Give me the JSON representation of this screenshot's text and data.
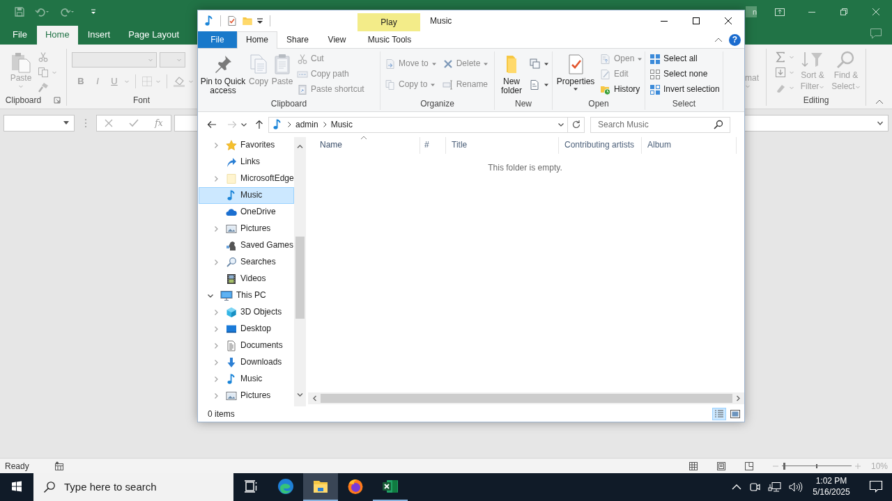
{
  "excel": {
    "tabs": [
      {
        "label": "File",
        "selected": false
      },
      {
        "label": "Home",
        "selected": true
      },
      {
        "label": "Insert",
        "selected": false
      },
      {
        "label": "Page Layout",
        "selected": false
      }
    ],
    "sign_in": "n",
    "paste": "Paste",
    "clipboard_group": "Clipboard",
    "font_buttons": [
      {
        "label": "B",
        "kind": "bold"
      },
      {
        "label": "I",
        "kind": "italic"
      },
      {
        "label": "U",
        "kind": "underline"
      }
    ],
    "font_group": "Font",
    "format_partial": "mat",
    "sort_filter": "Sort & Filter",
    "find_select": "Find & Select",
    "editing_group": "Editing",
    "formula_label": "fx",
    "status": "Ready",
    "zoom": "10%",
    "zoom_slider": {
      "level": 0.02
    }
  },
  "explorer": {
    "title": "Music",
    "context_header": "Play",
    "tabs": [
      {
        "label": "File",
        "kind": "file",
        "selected": false
      },
      {
        "label": "Home",
        "kind": "tab",
        "selected": true
      },
      {
        "label": "Share",
        "kind": "tab",
        "selected": false
      },
      {
        "label": "View",
        "kind": "tab",
        "selected": false
      },
      {
        "label": "Music Tools",
        "kind": "context",
        "selected": false
      }
    ],
    "help": "?",
    "ribbon": [
      {
        "label": "Clipboard",
        "columns": [
          [
            {
              "kind": "pin",
              "label": "Pin to Quick access",
              "disabled": false
            }
          ],
          [
            {
              "kind": "copy",
              "label": "Copy",
              "disabled": true
            }
          ],
          [
            {
              "kind": "paste",
              "label": "Paste",
              "disabled": true
            }
          ],
          [
            {
              "kind": "cut",
              "label": "Cut",
              "disabled": true
            },
            {
              "kind": "copy-path",
              "label": "Copy path",
              "disabled": true
            },
            {
              "kind": "paste-shortcut",
              "label": "Paste shortcut",
              "disabled": true
            }
          ]
        ]
      },
      {
        "label": "Organize",
        "columns": [
          [
            {
              "kind": "move-to",
              "label": "Move to",
              "dropdown": true,
              "disabled": true
            },
            {
              "kind": "copy-to",
              "label": "Copy to",
              "dropdown": true,
              "disabled": true
            }
          ],
          [
            {
              "kind": "delete",
              "label": "Delete",
              "dropdown": true,
              "disabled": true
            },
            {
              "kind": "rename",
              "label": "Rename",
              "disabled": true
            }
          ]
        ]
      },
      {
        "label": "New",
        "columns": [
          [
            {
              "kind": "new-folder",
              "label": "New folder",
              "disabled": false
            }
          ],
          [
            {
              "kind": "new-item",
              "dropdown": true,
              "disabled": false
            },
            {
              "kind": "easy-access",
              "dropdown": true,
              "disabled": false
            }
          ]
        ]
      },
      {
        "label": "Open",
        "columns": [
          [
            {
              "kind": "properties",
              "label": "Properties",
              "dropdown": true,
              "disabled": false
            }
          ],
          [
            {
              "kind": "open",
              "label": "Open",
              "dropdown": true,
              "disabled": true
            },
            {
              "kind": "edit",
              "label": "Edit",
              "disabled": true
            },
            {
              "kind": "history",
              "label": "History",
              "disabled": false
            }
          ]
        ]
      },
      {
        "label": "Select",
        "columns": [
          [
            {
              "kind": "select-all",
              "label": "Select all",
              "disabled": false
            },
            {
              "kind": "select-none",
              "label": "Select none",
              "disabled": false
            },
            {
              "kind": "invert-selection",
              "label": "Invert selection",
              "disabled": false
            }
          ]
        ]
      }
    ],
    "history_buttons": [
      {
        "kind": "back",
        "disabled": false
      },
      {
        "kind": "forward",
        "disabled": true
      }
    ],
    "address": [
      "admin",
      "Music"
    ],
    "search_placeholder": "Search Music",
    "nav": [
      {
        "children": [
          {
            "label": "Favorites",
            "kind": "star",
            "expanded": false,
            "selected": false
          },
          {
            "label": "Links",
            "kind": "link",
            "selected": false
          },
          {
            "label": "MicrosoftEdge",
            "kind": "folder",
            "expanded": false,
            "selected": false
          },
          {
            "label": "Music",
            "kind": "music",
            "selected": true
          },
          {
            "label": "OneDrive",
            "kind": "cloud",
            "selected": false
          },
          {
            "label": "Pictures",
            "kind": "pictures",
            "expanded": false,
            "selected": false
          },
          {
            "label": "Saved Games",
            "kind": "games",
            "selected": false
          },
          {
            "label": "Searches",
            "kind": "search",
            "expanded": false,
            "selected": false
          },
          {
            "label": "Videos",
            "kind": "videos",
            "selected": false
          }
        ]
      },
      {
        "label": "This PC",
        "kind": "pc",
        "expanded": true,
        "selected": false,
        "children": [
          {
            "label": "3D Objects",
            "kind": "cube",
            "expanded": false,
            "selected": false
          },
          {
            "label": "Desktop",
            "kind": "desktop",
            "expanded": false,
            "selected": false
          },
          {
            "label": "Documents",
            "kind": "documents",
            "expanded": false,
            "selected": false
          },
          {
            "label": "Downloads",
            "kind": "downloads",
            "expanded": false,
            "selected": false
          },
          {
            "label": "Music",
            "kind": "music",
            "expanded": false,
            "selected": false
          },
          {
            "label": "Pictures",
            "kind": "pictures",
            "expanded": false,
            "selected": false
          }
        ]
      }
    ],
    "columns": [
      {
        "label": "Name",
        "sorted": true
      },
      {
        "label": "#",
        "sorted": false
      },
      {
        "label": "Title",
        "sorted": false
      },
      {
        "label": "Contributing artists",
        "sorted": false
      },
      {
        "label": "Album",
        "sorted": false
      }
    ],
    "empty_message": "This folder is empty.",
    "status": "0 items",
    "views": [
      {
        "kind": "details",
        "selected": true
      },
      {
        "kind": "large-icons",
        "selected": false
      }
    ]
  },
  "taskbar": {
    "search_placeholder": "Type here to search",
    "apps": [
      {
        "kind": "task-view",
        "active": false,
        "running": false
      },
      {
        "kind": "edge",
        "active": false,
        "running": false
      },
      {
        "kind": "explorer",
        "active": true,
        "running": true
      },
      {
        "kind": "firefox",
        "active": false,
        "running": false
      },
      {
        "kind": "excel",
        "active": false,
        "running": true
      }
    ],
    "time": "1:02 PM",
    "date": "5/16/2025"
  }
}
